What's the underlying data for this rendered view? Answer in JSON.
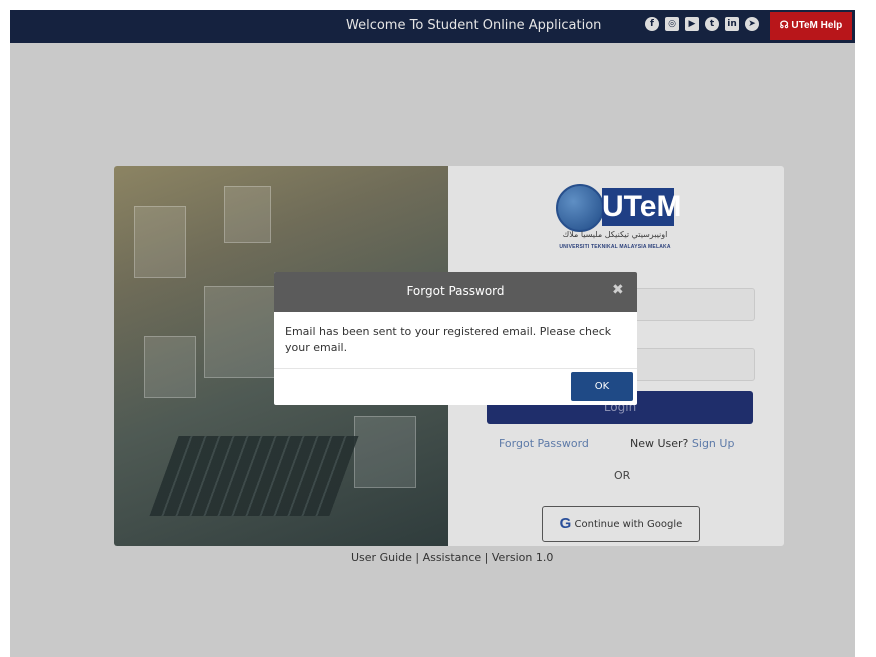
{
  "topbar": {
    "title": "Welcome To Student Online Application",
    "social_icons": [
      "facebook-icon",
      "instagram-icon",
      "youtube-icon",
      "twitter-icon",
      "linkedin-icon",
      "telegram-icon"
    ],
    "help_label": "☊ UTeM Help"
  },
  "logo": {
    "brand": "UTeM",
    "jawi": "اونيبرسيتي تيكنيكل مليسيا ملاك",
    "fullname": "UNIVERSITI TEKNIKAL MALAYSIA MELAKA"
  },
  "login": {
    "button_label": "Login",
    "forgot_label": "Forgot Password",
    "new_user_label": "New User?",
    "signup_label": "Sign Up",
    "or_label": "OR",
    "google_g": "G",
    "google_label": "Continue with Google"
  },
  "footer": {
    "text": "User Guide | Assistance | Version 1.0"
  },
  "modal": {
    "title": "Forgot Password",
    "close_glyph": "✖",
    "message": "Email has been sent to your registered email. Please check your email.",
    "ok_label": "OK"
  },
  "colors": {
    "topbar": "#15223f",
    "help": "#b8161a",
    "login_button": "#1f2e6b",
    "link": "#5d7aa8",
    "modal_header": "#5b5b5b",
    "ok_button": "#1f4a86"
  }
}
